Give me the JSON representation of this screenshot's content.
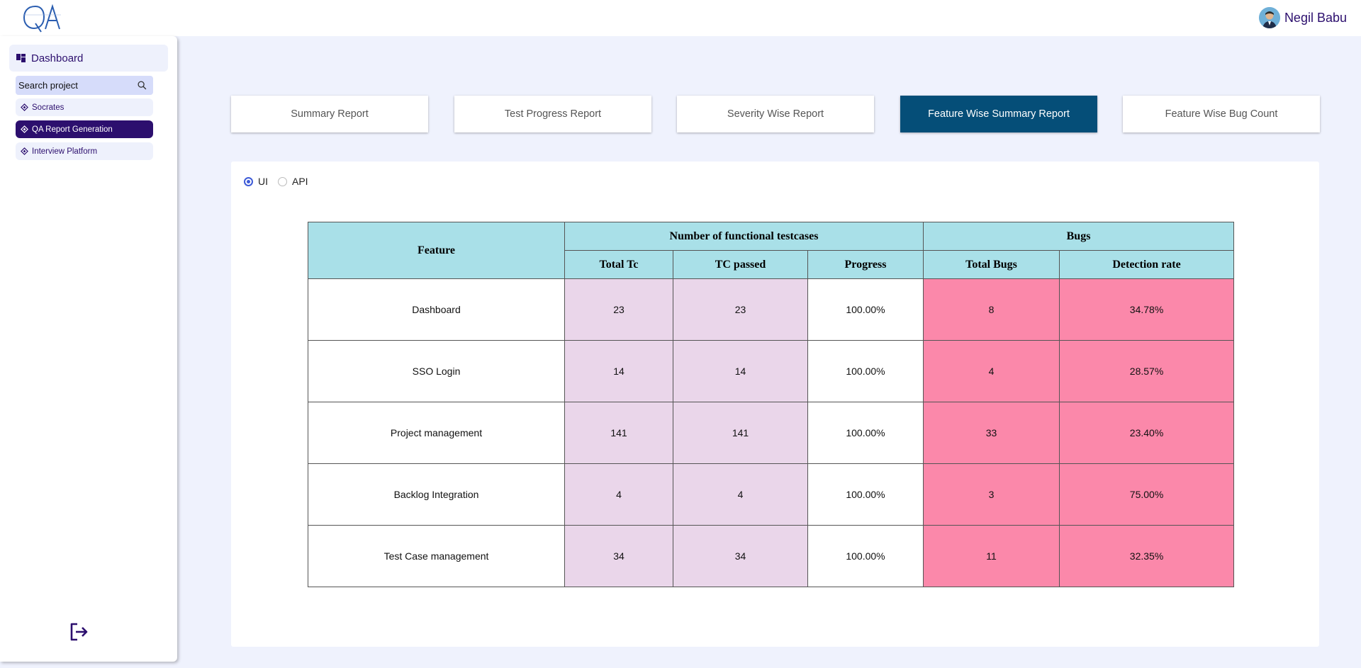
{
  "header": {
    "user_name": "Negil Babu"
  },
  "sidebar": {
    "dashboard_label": "Dashboard",
    "search_placeholder": "Search project",
    "projects": [
      {
        "label": "Socrates",
        "active": false
      },
      {
        "label": "QA Report Generation",
        "active": true
      },
      {
        "label": "Interview Platform",
        "active": false
      }
    ]
  },
  "tabs": [
    {
      "label": "Summary Report",
      "active": false
    },
    {
      "label": "Test Progress Report",
      "active": false
    },
    {
      "label": "Severity Wise Report",
      "active": false
    },
    {
      "label": "Feature Wise Summary Report",
      "active": true
    },
    {
      "label": "Feature Wise Bug Count",
      "active": false
    }
  ],
  "filter": {
    "options": [
      {
        "label": "UI",
        "selected": true
      },
      {
        "label": "API",
        "selected": false
      }
    ]
  },
  "table": {
    "group_headers": {
      "feature": "Feature",
      "testcases": "Number of functional testcases",
      "bugs": "Bugs"
    },
    "sub_headers": [
      "Total Tc",
      "TC passed",
      "Progress",
      "Total Bugs",
      "Detection rate"
    ],
    "rows": [
      {
        "feature": "Dashboard",
        "total_tc": "23",
        "tc_passed": "23",
        "progress": "100.00%",
        "total_bugs": "8",
        "detection_rate": "34.78%"
      },
      {
        "feature": "SSO Login",
        "total_tc": "14",
        "tc_passed": "14",
        "progress": "100.00%",
        "total_bugs": "4",
        "detection_rate": "28.57%"
      },
      {
        "feature": "Project management",
        "total_tc": "141",
        "tc_passed": "141",
        "progress": "100.00%",
        "total_bugs": "33",
        "detection_rate": "23.40%"
      },
      {
        "feature": "Backlog Integration",
        "total_tc": "4",
        "tc_passed": "4",
        "progress": "100.00%",
        "total_bugs": "3",
        "detection_rate": "75.00%"
      },
      {
        "feature": "Test Case management",
        "total_tc": "34",
        "tc_passed": "34",
        "progress": "100.00%",
        "total_bugs": "11",
        "detection_rate": "32.35%"
      }
    ]
  },
  "colors": {
    "brand": "#2c0f6e",
    "active_tab": "#054e78",
    "header_cell": "#a9e0e8",
    "testcase_cell": "#ead6ea",
    "bug_cell": "#fb88aa",
    "background": "#eff2fd"
  },
  "icons": {
    "logo": "qa-logo",
    "dashboard": "dashboard-grid-icon",
    "search": "search-icon",
    "project": "diamond-icon",
    "logout": "logout-icon",
    "avatar": "user-avatar"
  }
}
